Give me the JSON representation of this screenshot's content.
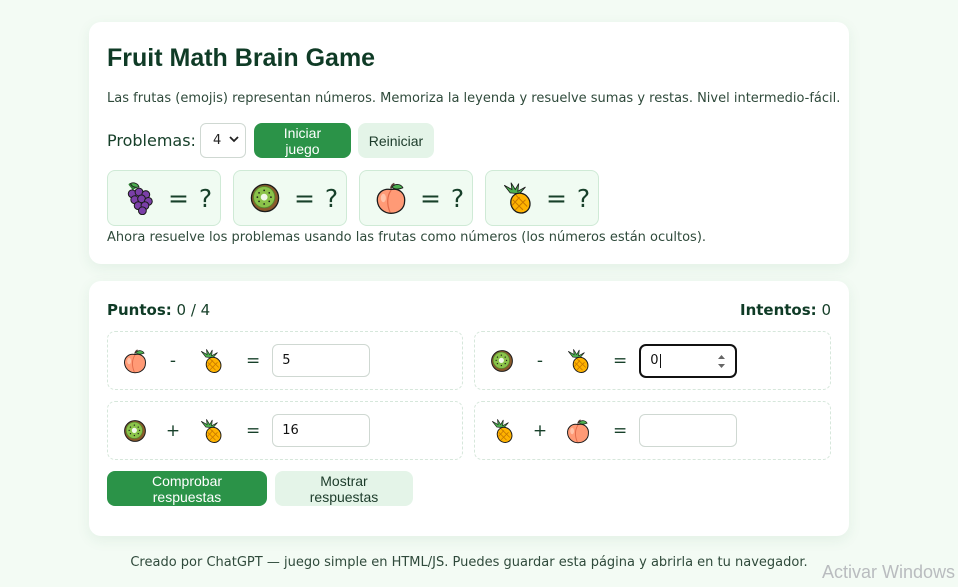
{
  "header": {
    "title": "Fruit Math Brain Game",
    "description": "Las frutas (emojis) representan números. Memoriza la leyenda y resuelve sumas y restas. Nivel intermedio-fácil."
  },
  "controls": {
    "problems_label": "Problemas:",
    "problems_value": "4",
    "start_label": "Iniciar juego",
    "reset_label": "Reiniciar"
  },
  "legend": [
    {
      "fruit": "grapes-icon",
      "value": "= ?"
    },
    {
      "fruit": "kiwi-icon",
      "value": "= ?"
    },
    {
      "fruit": "peach-icon",
      "value": "= ?"
    },
    {
      "fruit": "pineapple-icon",
      "value": "= ?"
    }
  ],
  "hint": "Ahora resuelve los problemas usando las frutas como números (los números están ocultos).",
  "score": {
    "points_label": "Puntos:",
    "points_value": "0 / 4",
    "attempts_label": "Intentos:",
    "attempts_value": "0"
  },
  "problems": [
    {
      "left": "peach-icon",
      "op": "-",
      "right": "pineapple-icon",
      "eq": "=",
      "answer": "5"
    },
    {
      "left": "kiwi-icon",
      "op": "-",
      "right": "pineapple-icon",
      "eq": "=",
      "answer": "0"
    },
    {
      "left": "kiwi-icon",
      "op": "+",
      "right": "pineapple-icon",
      "eq": "=",
      "answer": "16"
    },
    {
      "left": "pineapple-icon",
      "op": "+",
      "right": "peach-icon",
      "eq": "=",
      "answer": ""
    }
  ],
  "actions": {
    "check_label": "Comprobar respuestas",
    "show_label": "Mostrar respuestas"
  },
  "footer": "Creado por ChatGPT — juego simple en HTML/JS. Puedes guardar esta página y abrirla en tu navegador.",
  "watermark": "Activar Windows",
  "colors": {
    "primary": "#2b9348",
    "secondary": "#e4f4e8",
    "legend_bg": "#f0fbf2",
    "page_bg": "#f3fbf4",
    "text": "#17402a"
  }
}
